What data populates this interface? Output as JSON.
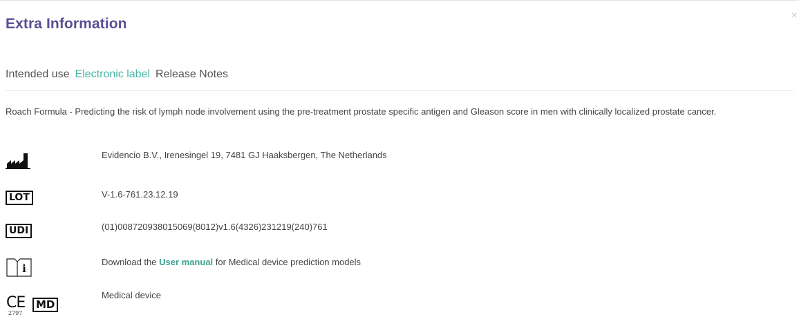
{
  "modal": {
    "title": "Extra Information",
    "close_label": "×"
  },
  "tabs": [
    {
      "label": "Intended use",
      "active": false
    },
    {
      "label": "Electronic label",
      "active": true
    },
    {
      "label": "Release Notes",
      "active": false
    }
  ],
  "description": "Roach Formula - Predicting the risk of lymph node involvement using the pre-treatment prostate specific antigen and Gleason score in men with clinically localized prostate cancer.",
  "label_rows": {
    "manufacturer": {
      "icon": "factory-icon",
      "text": "Evidencio B.V., Irenesingel 19, 7481 GJ Haaksbergen, The Netherlands"
    },
    "lot": {
      "icon": "lot-icon",
      "symbol": "LOT",
      "text": "V-1.6-761.23.12.19"
    },
    "udi": {
      "icon": "udi-icon",
      "symbol": "UDI",
      "text": "(01)008720938015069(8012)v1.6(4326)231219(240)761"
    },
    "manual": {
      "icon": "instructions-icon",
      "text_before": "Download the ",
      "link": "User manual",
      "text_after": " for Medical device prediction models"
    },
    "medical_device": {
      "icon": "ce-mark-icon",
      "ce": "CE",
      "ce_number": "2797",
      "symbol": "MD",
      "text": "Medical device"
    }
  },
  "colors": {
    "title": "#5a4f94",
    "active_tab": "#4ab3a4",
    "link": "#3aa391"
  }
}
